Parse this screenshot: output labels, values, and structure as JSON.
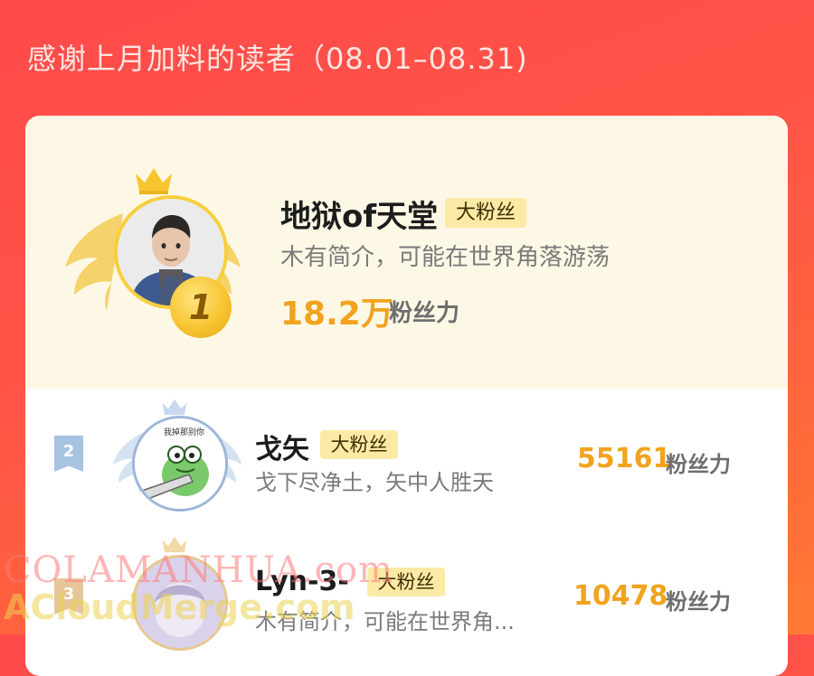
{
  "header": {
    "title": "感谢上月加料的读者（08.01–08.31)"
  },
  "ranking": [
    {
      "rank": "1",
      "name": "地狱of天堂",
      "badge": "大粉丝",
      "bio": "木有简介，可能在世界角落游荡",
      "score": "18.2万",
      "score_unit": "粉丝力"
    },
    {
      "rank": "2",
      "name": "戈矢",
      "badge": "大粉丝",
      "bio": "戈下尽净土，矢中人胜天",
      "score": "55161",
      "score_unit": "粉丝力",
      "avatar_caption": "我掉那别你"
    },
    {
      "rank": "3",
      "name": "Lyn-3-",
      "badge": "大粉丝",
      "bio": "木有简介，可能在世界角...",
      "score": "10478",
      "score_unit": "粉丝力"
    }
  ],
  "watermark": {
    "line1": "COLAMANHUA.com",
    "line2": "ACloudMerge.com"
  },
  "colors": {
    "background": "#ff4b4b",
    "accent_gold": "#f2a31e",
    "badge_bg": "#fbeaa6",
    "top_card_bg": "#fdf8e6"
  }
}
